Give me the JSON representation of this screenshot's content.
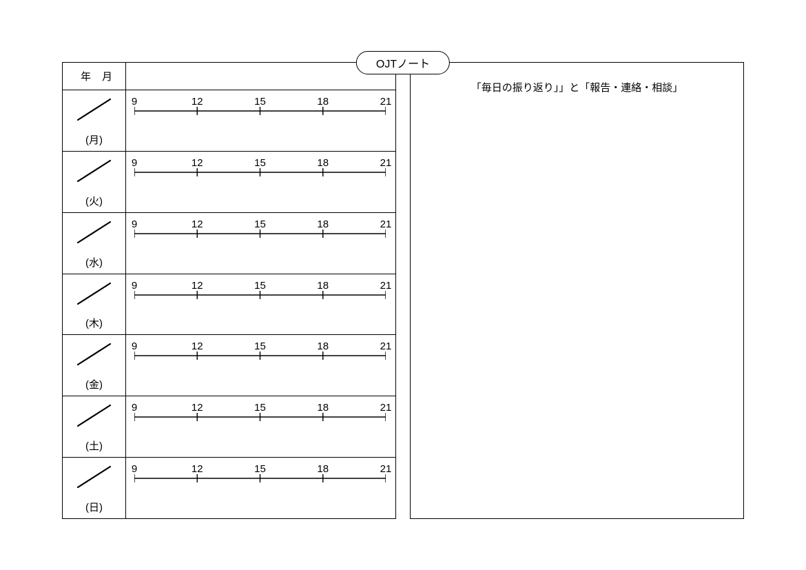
{
  "title": "OJTノート",
  "header": {
    "year_label": "年",
    "month_label": "月"
  },
  "right_panel": {
    "title": "「毎日の振り返り」」と「報告・連絡・相談」"
  },
  "timeline": {
    "labels": [
      "9",
      "12",
      "15",
      "18",
      "21"
    ]
  },
  "days": [
    {
      "label": "(月)"
    },
    {
      "label": "(火)"
    },
    {
      "label": "(水)"
    },
    {
      "label": "(木)"
    },
    {
      "label": "(金)"
    },
    {
      "label": "(土)"
    },
    {
      "label": "(日)"
    }
  ]
}
